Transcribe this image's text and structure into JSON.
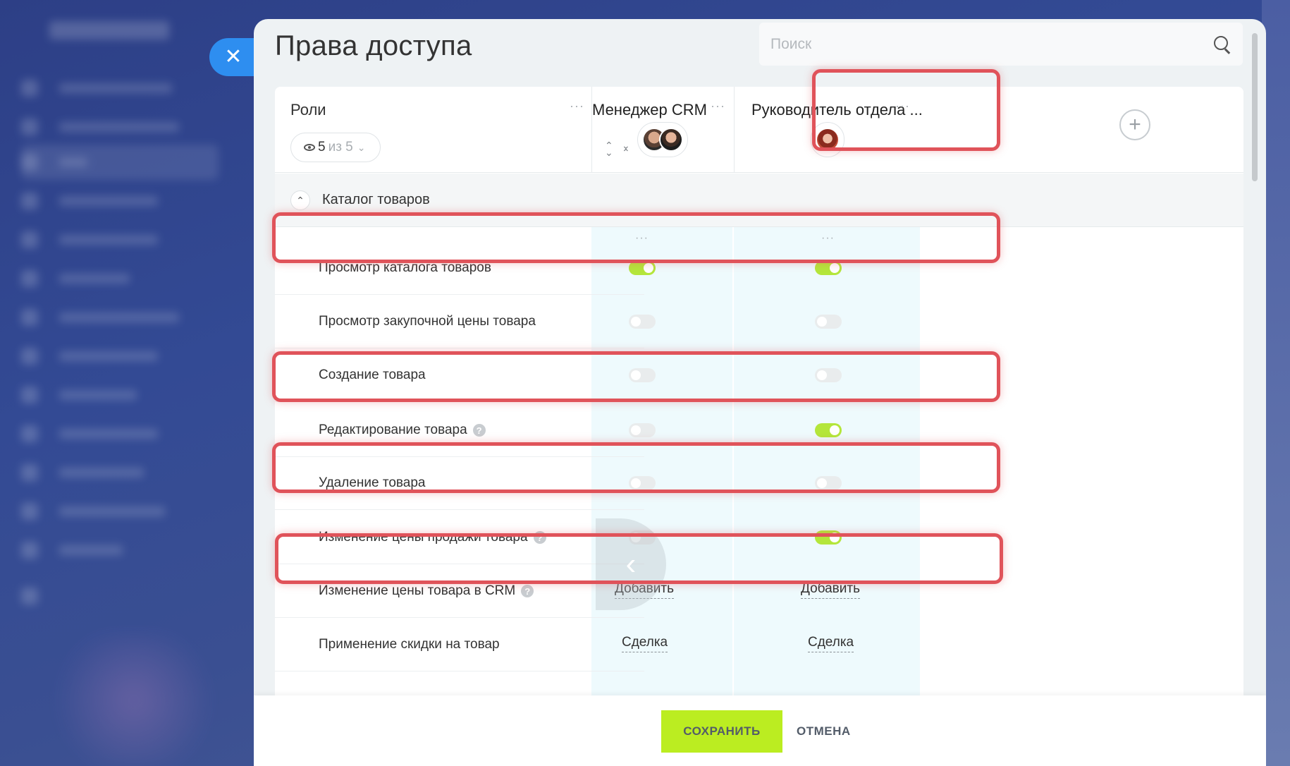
{
  "panel": {
    "title": "Права доступа",
    "close_icon": "close-icon",
    "search": {
      "placeholder": "Поиск",
      "value": ""
    }
  },
  "roles_header": {
    "label": "Роли",
    "counter_shown": "5",
    "counter_of": "из 5",
    "more": "···"
  },
  "roles": [
    {
      "name": "Менеджер CRM",
      "avatars": 2
    },
    {
      "name": "Руководитель отдела ...",
      "avatars": 1
    }
  ],
  "section": {
    "title": "Каталог товаров"
  },
  "permissions": [
    {
      "label": "Просмотр каталога товаров",
      "help": false,
      "type": "toggle",
      "values": [
        true,
        true
      ]
    },
    {
      "label": "Просмотр закупочной цены товара",
      "help": false,
      "type": "toggle",
      "values": [
        false,
        false
      ]
    },
    {
      "label": "Создание товара",
      "help": false,
      "type": "toggle",
      "values": [
        false,
        false
      ]
    },
    {
      "label": "Редактирование товара",
      "help": true,
      "type": "toggle",
      "values": [
        false,
        true
      ]
    },
    {
      "label": "Удаление товара",
      "help": false,
      "type": "toggle",
      "values": [
        false,
        false
      ]
    },
    {
      "label": "Изменение цены продажи товара",
      "help": true,
      "type": "toggle",
      "values": [
        false,
        true
      ]
    },
    {
      "label": "Изменение цены товара в CRM",
      "help": true,
      "type": "link",
      "values": [
        "Добавить",
        "Добавить"
      ]
    },
    {
      "label": "Применение скидки на товар",
      "help": false,
      "type": "link",
      "values": [
        "Сделка",
        "Сделка"
      ]
    }
  ],
  "help_symbol": "?",
  "footer": {
    "save_label": "СОХРАНИТЬ",
    "cancel_label": "ОТМЕНА"
  },
  "colors": {
    "accent": "#2e8ef0",
    "toggle_on": "#b4e63b",
    "highlight": "#e0535a",
    "save": "#bbed21"
  }
}
